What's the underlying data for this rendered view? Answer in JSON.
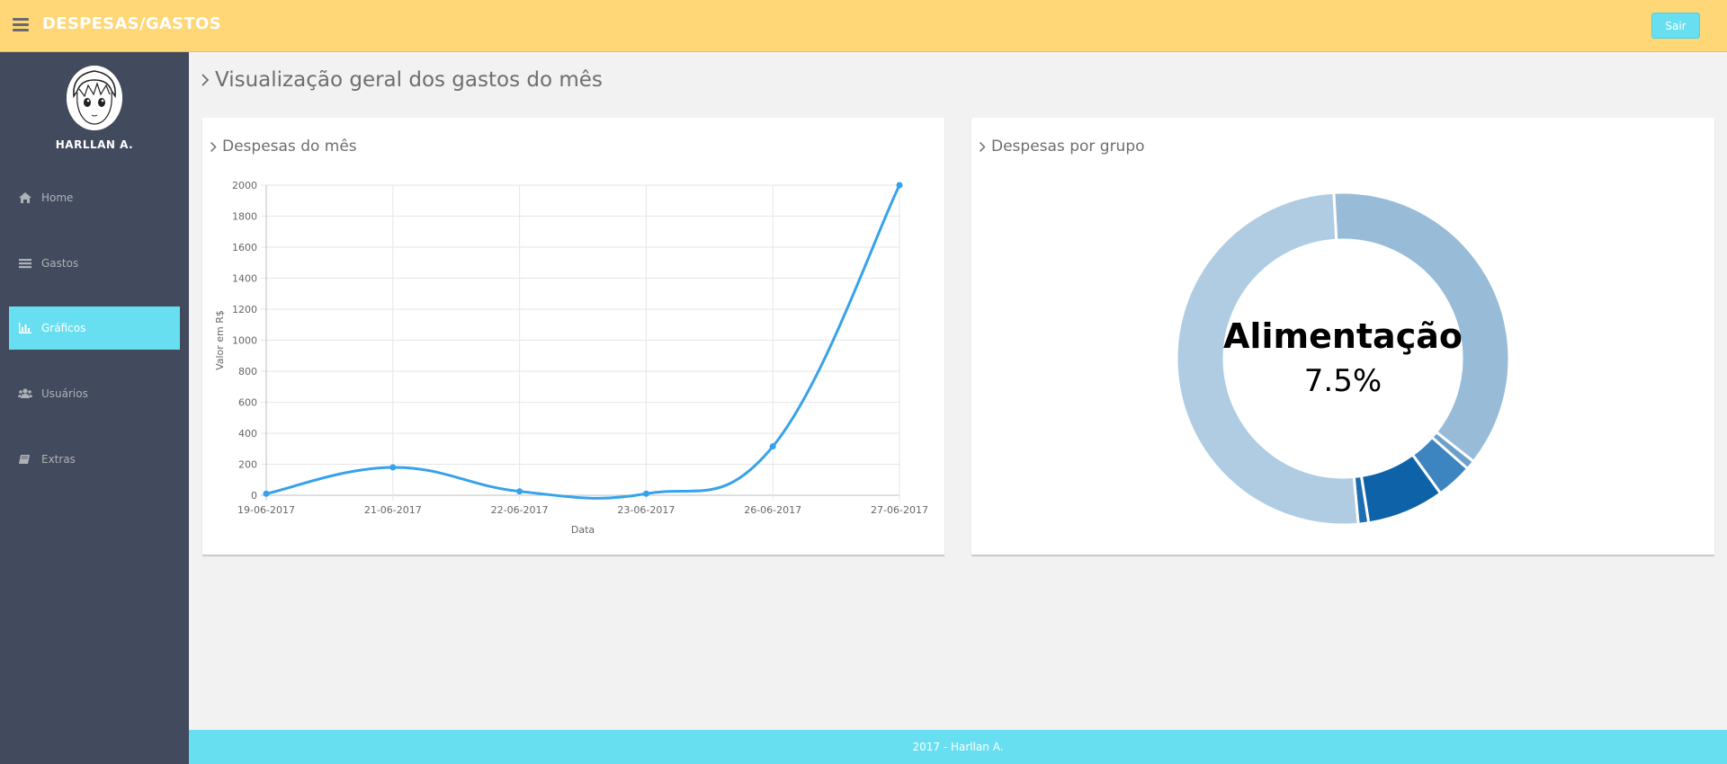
{
  "header": {
    "brand": "DESPESAS/GASTOS",
    "logout_label": "Sair"
  },
  "sidebar": {
    "user_name": "HARLLAN A.",
    "items": [
      {
        "label": "Home",
        "icon": "home-icon"
      },
      {
        "label": "Gastos",
        "icon": "list-icon"
      },
      {
        "label": "Gráficos",
        "icon": "bar-chart-icon",
        "active": true
      },
      {
        "label": "Usuários",
        "icon": "users-icon"
      },
      {
        "label": "Extras",
        "icon": "book-icon"
      }
    ]
  },
  "main": {
    "title": "Visualização geral dos gastos do mês"
  },
  "panels": {
    "line_title": "Despesas do mês",
    "donut_title": "Despesas por grupo"
  },
  "chart_data": [
    {
      "type": "line",
      "x": [
        "19-06-2017",
        "21-06-2017",
        "22-06-2017",
        "23-06-2017",
        "26-06-2017",
        "27-06-2017"
      ],
      "series": [
        {
          "values": [
            10,
            180,
            25,
            10,
            315,
            2000
          ],
          "color": "#36a2eb"
        }
      ],
      "xlabel": "Data",
      "ylabel": "Valor em R$",
      "ylim": [
        0,
        2000
      ],
      "yticks": [
        0,
        200,
        400,
        600,
        800,
        1000,
        1200,
        1400,
        1600,
        1800,
        2000
      ],
      "grid": true
    },
    {
      "type": "pie",
      "donut": true,
      "center_label": "Alimentação",
      "center_value": "7.5%",
      "slices": [
        {
          "value": 36.5,
          "color": "#98bcd8"
        },
        {
          "value": 0.9,
          "color": "#6aa0cb"
        },
        {
          "value": 3.5,
          "color": "#3d85c0"
        },
        {
          "value": 7.5,
          "color": "#0e63a8"
        },
        {
          "value": 1.0,
          "color": "#1c6eb0"
        },
        {
          "value": 50.6,
          "color": "#afcce2"
        }
      ]
    }
  ],
  "footer": {
    "text": "2017 - Harllan A."
  }
}
